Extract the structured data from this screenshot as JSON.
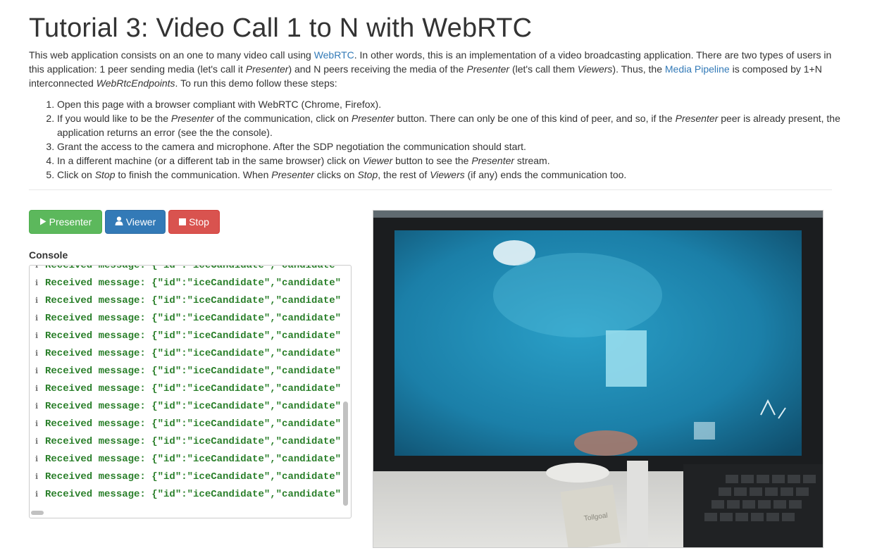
{
  "header": {
    "title": "Tutorial 3: Video Call 1 to N with WebRTC"
  },
  "intro": {
    "p1": "This web application consists on an one to many video call using ",
    "link_webrtc": "WebRTC",
    "p2": ". In other words, this is an implementation of a video broadcasting application. There are two types of users in this application: 1 peer sending media (let's call it ",
    "em_presenter": "Presenter",
    "p3": ") and N peers receiving the media of the ",
    "em_presenter2": "Presenter",
    "p4": " (let's call them ",
    "em_viewers": "Viewers",
    "p5": "). Thus, the ",
    "link_pipeline": "Media Pipeline",
    "p6": " is composed by 1+N interconnected ",
    "em_endpoints": "WebRtcEndpoints",
    "p7": ". To run this demo follow these steps:"
  },
  "steps": {
    "s1": "Open this page with a browser compliant with WebRTC (Chrome, Firefox).",
    "s2a": "If you would like to be the ",
    "s2b": "Presenter",
    "s2c": " of the communication, click on ",
    "s2d": "Presenter",
    "s2e": " button. There can only be one of this kind of peer, and so, if the ",
    "s2f": "Presenter",
    "s2g": " peer is already present, the application returns an error (see the the console).",
    "s3": "Grant the access to the camera and microphone. After the SDP negotiation the communication should start.",
    "s4a": "In a different machine (or a different tab in the same browser) click on ",
    "s4b": "Viewer",
    "s4c": " button to see the ",
    "s4d": "Presenter",
    "s4e": " stream.",
    "s5a": "Click on ",
    "s5b": "Stop",
    "s5c": " to finish the communication. When ",
    "s5d": "Presenter",
    "s5e": " clicks on ",
    "s5f": "Stop",
    "s5g": ", the rest of ",
    "s5h": "Viewers",
    "s5i": " (if any) ends the communication too."
  },
  "buttons": {
    "presenter": "Presenter",
    "viewer": "Viewer",
    "stop": "Stop",
    "presenter_icon": "play-icon",
    "viewer_icon": "user-icon",
    "stop_icon": "stop-icon"
  },
  "console": {
    "label": "Console",
    "partial_top": "Received message: {\"id\":\"iceCandidate\",\"candidate\"",
    "lines": [
      "Received message: {\"id\":\"iceCandidate\",\"candidate\"",
      "Received message: {\"id\":\"iceCandidate\",\"candidate\"",
      "Received message: {\"id\":\"iceCandidate\",\"candidate\"",
      "Received message: {\"id\":\"iceCandidate\",\"candidate\"",
      "Received message: {\"id\":\"iceCandidate\",\"candidate\"",
      "Received message: {\"id\":\"iceCandidate\",\"candidate\"",
      "Received message: {\"id\":\"iceCandidate\",\"candidate\"",
      "Received message: {\"id\":\"iceCandidate\",\"candidate\"",
      "Received message: {\"id\":\"iceCandidate\",\"candidate\"",
      "Received message: {\"id\":\"iceCandidate\",\"candidate\"",
      "Received message: {\"id\":\"iceCandidate\",\"candidate\"",
      "Received message: {\"id\":\"iceCandidate\",\"candidate\"",
      "Received message: {\"id\":\"iceCandidate\",\"candidate\""
    ],
    "info_icon": "info-icon",
    "text_color": "#2a7f2a"
  },
  "video": {
    "tag": "Tollgoal"
  },
  "colors": {
    "green": "#5cb85c",
    "blue": "#337ab7",
    "red": "#d9534f",
    "link": "#337ab7"
  }
}
